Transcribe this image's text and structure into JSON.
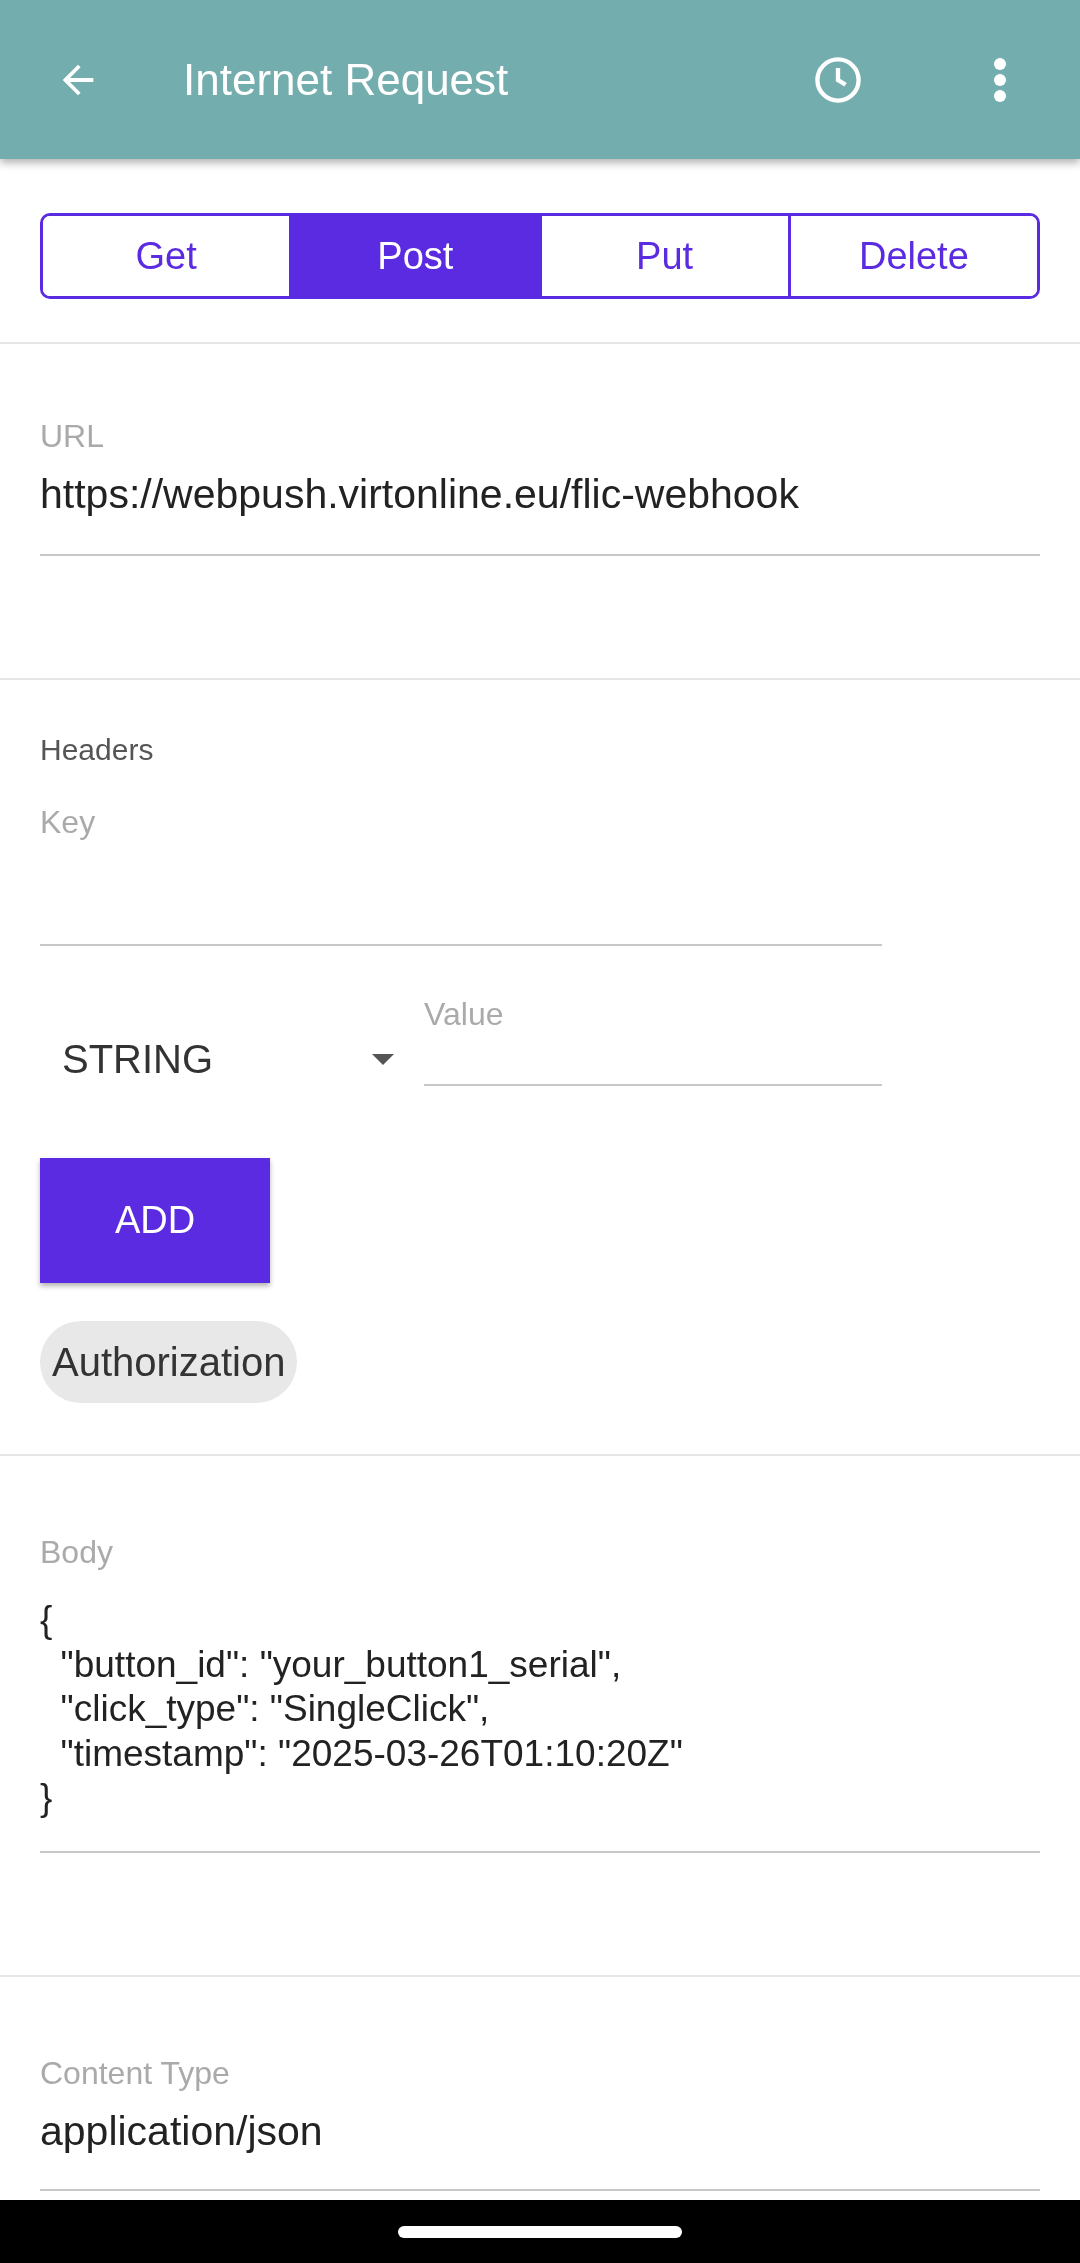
{
  "app_bar": {
    "title": "Internet Request"
  },
  "tabs": [
    {
      "label": "Get",
      "selected": false
    },
    {
      "label": "Post",
      "selected": true
    },
    {
      "label": "Put",
      "selected": false
    },
    {
      "label": "Delete",
      "selected": false
    }
  ],
  "url": {
    "label": "URL",
    "value": "https://webpush.virtonline.eu/flic-webhook"
  },
  "headers": {
    "label": "Headers",
    "key": {
      "placeholder": "Key"
    },
    "type": {
      "value": "STRING"
    },
    "value": {
      "placeholder": "Value"
    },
    "add_button": "ADD",
    "chips": [
      "Authorization"
    ]
  },
  "body": {
    "label": "Body",
    "lines": [
      "{",
      "  \"button_id\": \"your_button1_serial\",",
      "  \"click_type\": \"SingleClick\",",
      "  \"timestamp\": \"2025-03-26T01:10:20Z\"",
      "}"
    ]
  },
  "content_type": {
    "label": "Content Type",
    "value": "application/json"
  }
}
